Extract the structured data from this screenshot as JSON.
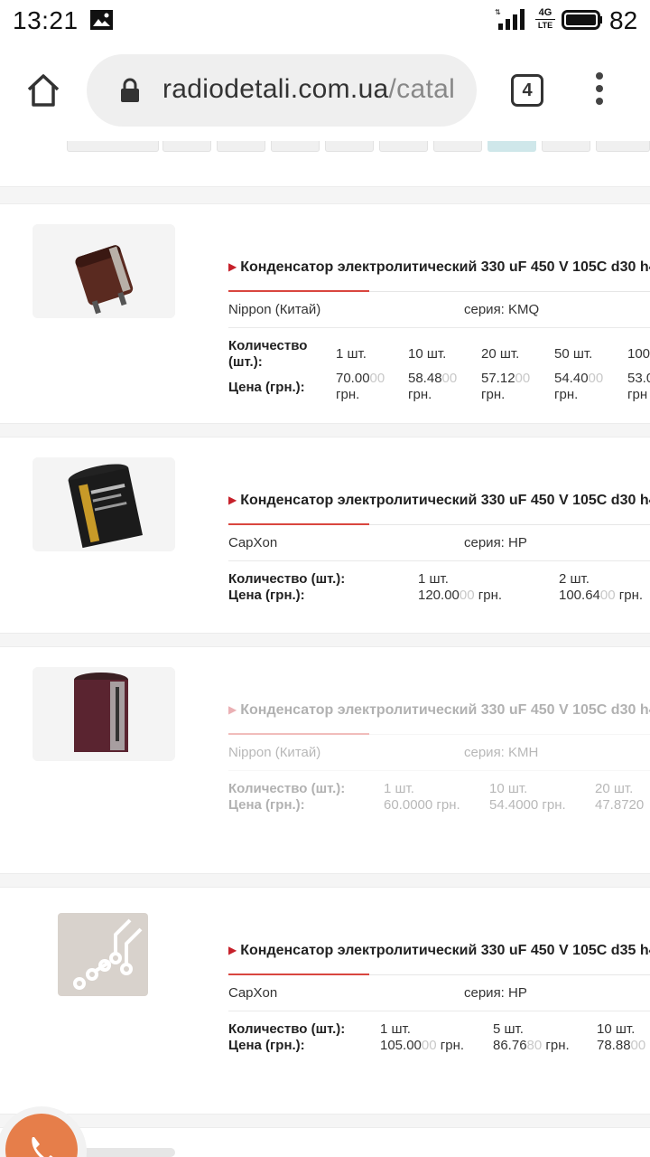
{
  "status_bar": {
    "time": "13:21",
    "network": "4G",
    "network_sub": "LTE",
    "battery": "82"
  },
  "browser": {
    "url_host": "radiodetali.com.ua",
    "url_path": "/catal",
    "tab_count": "4"
  },
  "products": [
    {
      "title": "Конденсатор электролитический 330 uF 450 V 105C d30 h4",
      "maker": "Nippon (Китай)",
      "series": "серия: KMQ",
      "qty_label": "Количество (шт.):",
      "qty_label_l1": "Количество",
      "qty_label_l2": "(шт.):",
      "price_label": "Цена (грн.):",
      "tiers": [
        {
          "qty": "1 шт.",
          "price": "70.00",
          "price_dim": "00",
          "unit": "грн."
        },
        {
          "qty": "10 шт.",
          "price": "58.48",
          "price_dim": "00",
          "unit": "грн."
        },
        {
          "qty": "20 шт.",
          "price": "57.12",
          "price_dim": "00",
          "unit": "грн."
        },
        {
          "qty": "50 шт.",
          "price": "54.40",
          "price_dim": "00",
          "unit": "грн."
        },
        {
          "qty": "100",
          "price": "53.0",
          "price_dim": "",
          "unit": "грн"
        }
      ]
    },
    {
      "title": "Конденсатор электролитический 330 uF 450 V 105C d30 h4",
      "maker": "CapXon",
      "series": "серия: HP",
      "qty_label": "Количество (шт.):",
      "price_label": "Цена (грн.):",
      "tiers": [
        {
          "qty": "1 шт.",
          "price": "120.00",
          "price_dim": "00",
          "unit": "грн."
        },
        {
          "qty": "2 шт.",
          "price": "100.64",
          "price_dim": "00",
          "unit": "грн."
        }
      ]
    },
    {
      "title": "Конденсатор электролитический 330 uF 450 V 105C d30 h4",
      "maker": "Nippon (Китай)",
      "series": "серия: KMH",
      "qty_label": "Количество (шт.):",
      "price_label": "Цена (грн.):",
      "tiers": [
        {
          "qty": "1 шт.",
          "price": "60.0000 грн."
        },
        {
          "qty": "10 шт.",
          "price": "54.4000 грн."
        },
        {
          "qty": "20 шт.",
          "price": "47.8720"
        }
      ]
    },
    {
      "title": "Конденсатор электролитический 330 uF 450 V 105C d35 h4",
      "maker": "CapXon",
      "series": "серия: HP",
      "qty_label": "Количество (шт.):",
      "price_label": "Цена (грн.):",
      "tiers": [
        {
          "qty": "1 шт.",
          "price": "105.00",
          "price_dim": "00",
          "unit": "грн."
        },
        {
          "qty": "5 шт.",
          "price": "86.76",
          "price_dim": "80",
          "unit": "грн."
        },
        {
          "qty": "10 шт.",
          "price": "78.88",
          "price_dim": "00",
          "unit": ""
        }
      ]
    }
  ],
  "colors": {
    "accent_red": "#c6202a",
    "active_page": "#cfe7ea",
    "call_button": "#e67e4a"
  }
}
